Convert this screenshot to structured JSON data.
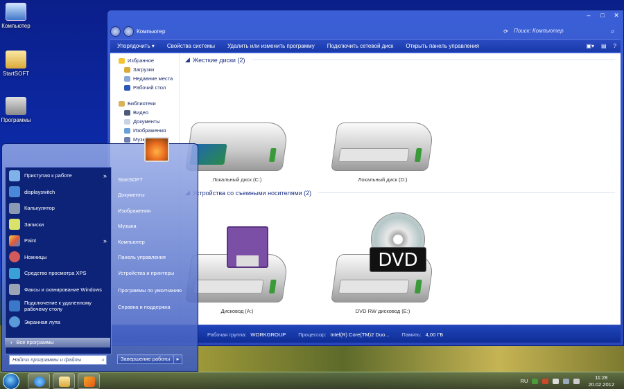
{
  "desktop": {
    "icons": [
      {
        "label": "Компьютер"
      },
      {
        "label": "StartSOFT"
      },
      {
        "label": "Программы"
      }
    ]
  },
  "explorer": {
    "breadcrumb": "Компьютер",
    "search_placeholder": "Поиск: Компьютер",
    "toolbar": {
      "organize": "Упорядочить ▾",
      "system_props": "Свойства системы",
      "uninstall": "Удалить или изменить программу",
      "map_drive": "Подключить сетевой диск",
      "control_panel": "Открыть панель управления"
    },
    "nav": {
      "favorites": "Избранное",
      "downloads": "Загрузки",
      "recent": "Недавние места",
      "desktop": "Рабочий стол",
      "libraries": "Библиотеки",
      "video": "Видео",
      "documents": "Документы",
      "images": "Изображения",
      "music": "Музыка"
    },
    "groups": {
      "hard_drives": "Жесткие диски (2)",
      "removable": "Устройства со съемными носителями (2)"
    },
    "drives": {
      "c": "Локальный диск (C:)",
      "d": "Локальный диск (D:)",
      "a": "Дисковод (A:)",
      "e": "DVD RW дисковод (E:)"
    },
    "dvd_label": "DVD",
    "details": {
      "workgroup_label": "Рабочая группа:",
      "workgroup_value": "WORKGROUP",
      "cpu_label": "Процессор:",
      "cpu_value": "Intel(R) Core(TM)2 Duo...",
      "mem_label": "Память:",
      "mem_value": "4,00 ГБ"
    }
  },
  "start_menu": {
    "programs": [
      {
        "label": "Приступая к работе",
        "arrow": true
      },
      {
        "label": "displayswitch"
      },
      {
        "label": "Калькулятор"
      },
      {
        "label": "Записки"
      },
      {
        "label": "Paint",
        "arrow": true
      },
      {
        "label": "Ножницы"
      },
      {
        "label": "Средство просмотра XPS"
      },
      {
        "label": "Факсы и сканирование Windows"
      },
      {
        "label": "Подключение к удаленному рабочему столу"
      },
      {
        "label": "Экранная лупа"
      }
    ],
    "all_programs": "Все программы",
    "search_placeholder": "Найти программы и файлы",
    "right": {
      "startsoft": "StartSOFT",
      "documents": "Документы",
      "images": "Изображения",
      "music": "Музыка",
      "computer": "Компьютер",
      "control_panel": "Панель управления",
      "devices": "Устройства и принтеры",
      "defaults": "Программы по умолчанию",
      "help": "Справка и поддержка"
    },
    "shutdown": "Завершение работы"
  },
  "taskbar": {
    "language": "RU",
    "time": "11:28",
    "date": "20.02.2012"
  }
}
